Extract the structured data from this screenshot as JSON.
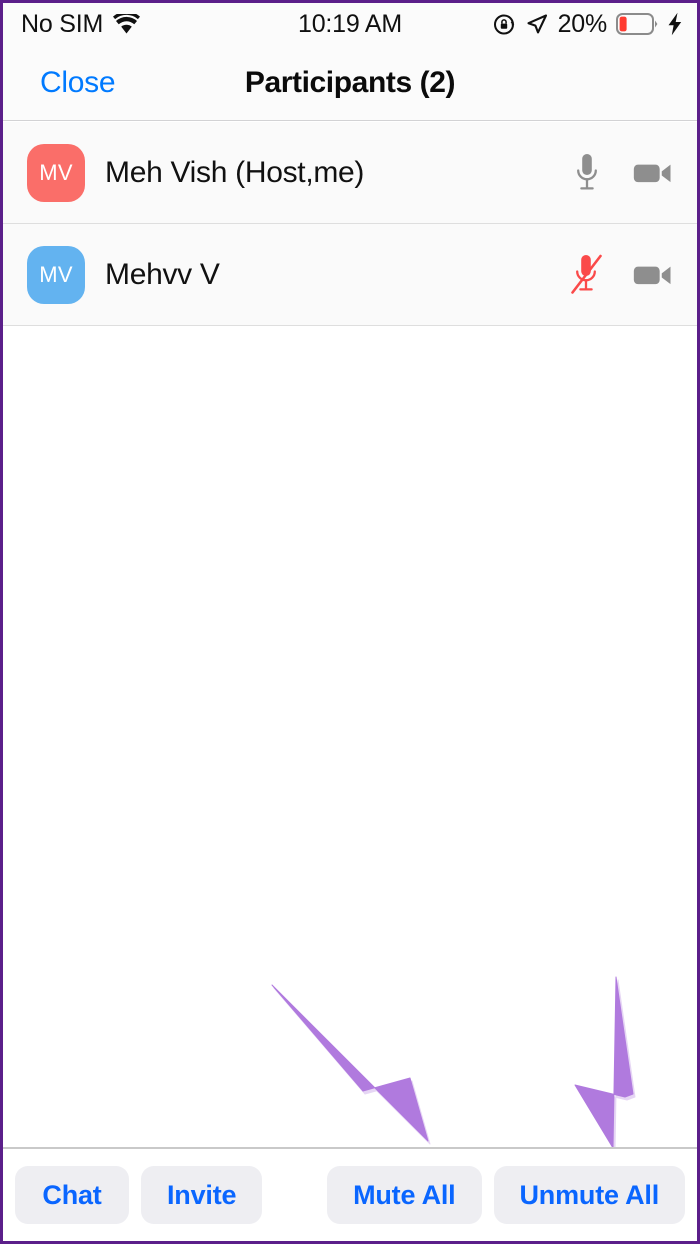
{
  "status_bar": {
    "carrier": "No SIM",
    "wifi_icon": "wifi-icon",
    "time": "10:19 AM",
    "rotation_lock_icon": "rotation-lock-icon",
    "location_icon": "location-arrow-icon",
    "battery_percent": "20%",
    "battery_level": 20,
    "battery_color": "#ff3b30",
    "charging_icon": "lightning-bolt-icon"
  },
  "nav": {
    "close_label": "Close",
    "title": "Participants (2)",
    "accent_color": "#007aff"
  },
  "participants": [
    {
      "initials": "MV",
      "name": "Meh Vish (Host,me)",
      "avatar_color": "#fa6e69",
      "mic_state": "unmuted",
      "mic_icon": "microphone-icon",
      "mic_color": "#8e8e8e",
      "camera_icon": "video-camera-icon",
      "camera_state": "on",
      "camera_color": "#8e8e8e"
    },
    {
      "initials": "MV",
      "name": "Mehvv V",
      "avatar_color": "#63b3f0",
      "mic_state": "muted",
      "mic_icon": "microphone-muted-icon",
      "mic_color": "#fa4a4a",
      "camera_icon": "video-camera-icon",
      "camera_state": "on",
      "camera_color": "#8e8e8e"
    }
  ],
  "annotations": {
    "arrow_color": "#b07ade",
    "arrows": [
      {
        "name": "arrow-pointing-to-mute-all",
        "direction": "down-right",
        "target": "Mute All"
      },
      {
        "name": "arrow-pointing-to-unmute-all",
        "direction": "down",
        "target": "Unmute All"
      }
    ]
  },
  "bottom_bar": {
    "button_color": "#0a66ff",
    "button_bg": "#eeeef2",
    "left_buttons": [
      {
        "label": "Chat",
        "name": "chat-button"
      },
      {
        "label": "Invite",
        "name": "invite-button"
      }
    ],
    "right_buttons": [
      {
        "label": "Mute All",
        "name": "mute-all-button"
      },
      {
        "label": "Unmute All",
        "name": "unmute-all-button"
      }
    ]
  }
}
